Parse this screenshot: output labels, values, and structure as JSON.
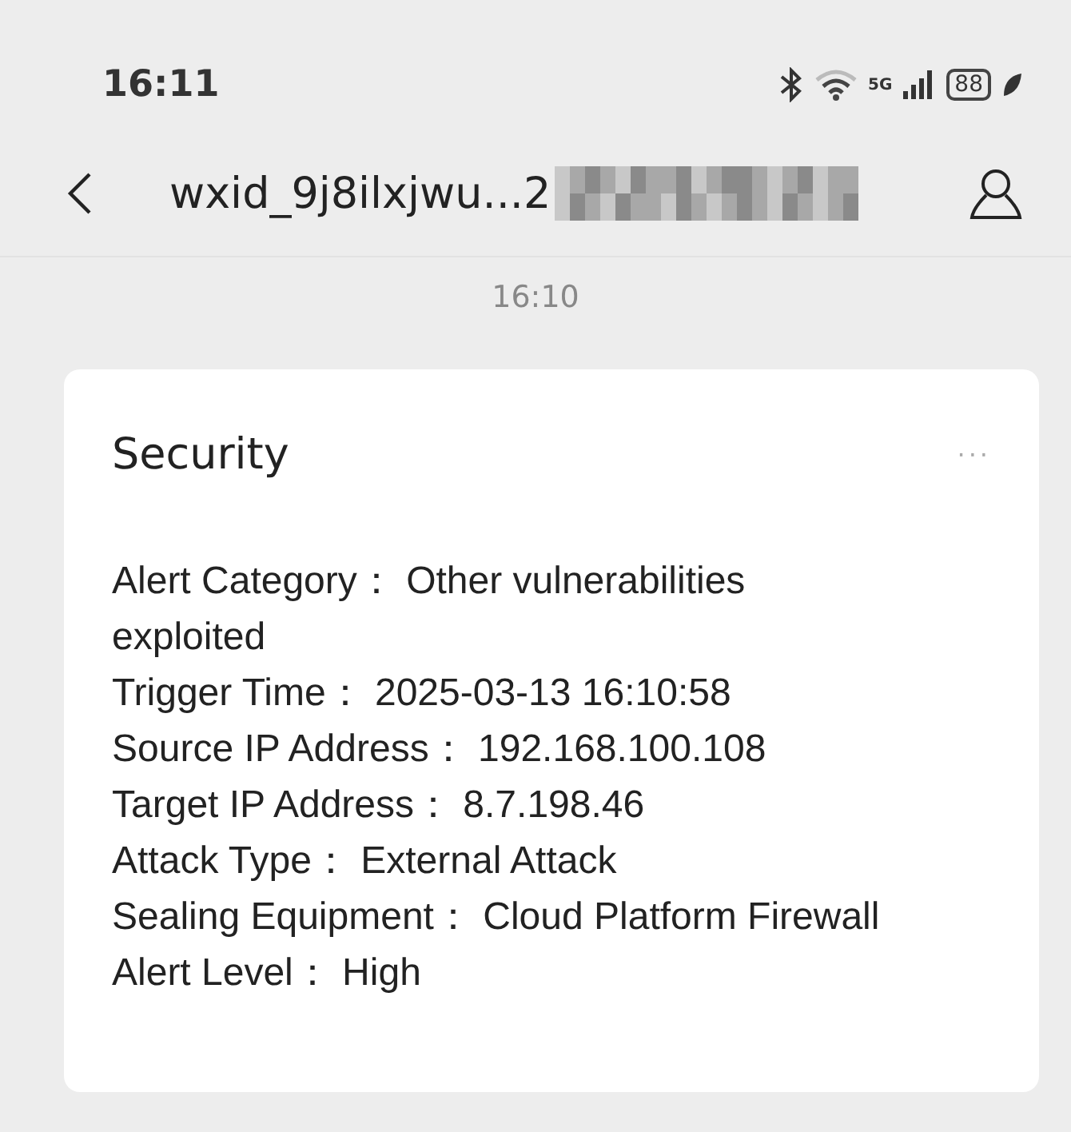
{
  "status_bar": {
    "time": "16:11",
    "network": "5G",
    "battery": "88"
  },
  "header": {
    "title": "wxid_9j8ilxjwu...2"
  },
  "timestamp": "16:10",
  "card": {
    "title": "Security",
    "more": "···",
    "lines": [
      "Alert Category： Other vulnerabilities exploited",
      "Trigger Time： 2025-03-13 16:10:58",
      "Source IP Address： 192.168.100.108",
      "Target IP Address： 8.7.198.46",
      "Attack Type： External Attack",
      "Sealing Equipment： Cloud Platform Firewall",
      "Alert Level： High"
    ]
  }
}
